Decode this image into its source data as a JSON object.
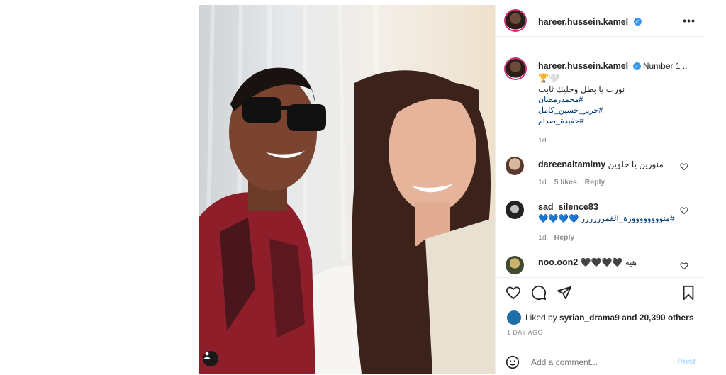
{
  "post": {
    "username": "hareer.hussein.kamel",
    "more_icon": "•••",
    "caption": {
      "lead": "Number 1 ..",
      "emoji_line": "🏆🤍",
      "line1": "نورت يا بطل وخليك ثابت",
      "hashtags": [
        "#محمدرمضان",
        "#حرير_حسين_كامل",
        "#حفيدة_صدام"
      ],
      "time": "1d"
    },
    "comments": [
      {
        "user": "dareenaltamimy",
        "text": "منورين يا حلوين",
        "time": "1d",
        "likes": "5 likes",
        "reply": "Reply"
      },
      {
        "user": "sad_silence83",
        "text": "#منوووووووورة_القمرررررر 💙💙💙💙",
        "time": "1d",
        "reply": "Reply"
      },
      {
        "user": "noo.oon2",
        "text": "هيه 🖤🖤🖤🖤"
      }
    ],
    "liked_by_user": "syrian_drama9",
    "likes_text": "and 20,390 others",
    "liked_by_prefix": "Liked by",
    "posted_ago": "1 DAY AGO",
    "add_comment_placeholder": "Add a comment...",
    "post_button": "Post"
  },
  "colors": {
    "link": "#00376b",
    "verified": "#3897f0",
    "post_button": "#b2dffc",
    "meta": "#8e8e8e"
  }
}
